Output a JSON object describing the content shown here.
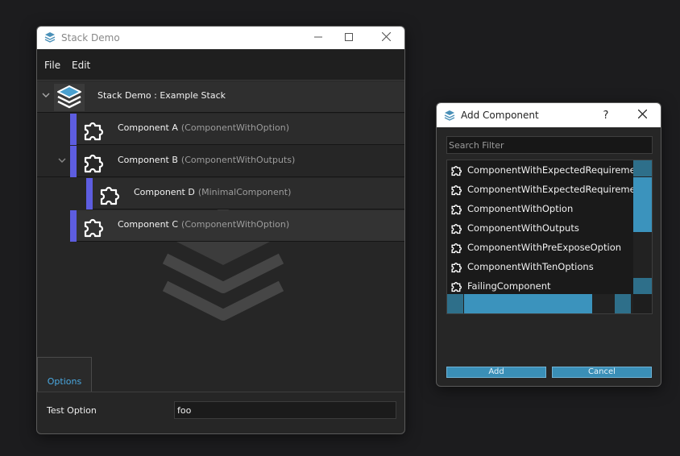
{
  "main_window": {
    "title": "Stack Demo",
    "app_icon": "stack-icon",
    "menu": [
      "File",
      "Edit"
    ],
    "tree": {
      "root": {
        "name": "Stack Demo : Example Stack",
        "icon": "stack-icon",
        "expanded": true
      },
      "items": [
        {
          "name": "Component A",
          "type": "(ComponentWithOption)",
          "depth": 1,
          "icon": "puzzle-icon",
          "expandable": false
        },
        {
          "name": "Component B",
          "type": "(ComponentWithOutputs)",
          "depth": 1,
          "icon": "puzzle-icon",
          "expandable": true
        },
        {
          "name": "Component D",
          "type": "(MinimalComponent)",
          "depth": 2,
          "icon": "puzzle-icon",
          "expandable": false
        },
        {
          "name": "Component C",
          "type": "(ComponentWithOption)",
          "depth": 1,
          "icon": "puzzle-icon",
          "expandable": false
        }
      ]
    },
    "tabs": [
      "Options"
    ],
    "options": [
      {
        "label": "Test Option",
        "value": "foo"
      }
    ],
    "colors": {
      "bar": "#5d5de0",
      "tab_text": "#4aa8e0"
    }
  },
  "dialog": {
    "title": "Add Component",
    "help": "?",
    "close": "✕",
    "search_placeholder": "Search Filter",
    "items": [
      "ComponentWithExpectedRequirement",
      "ComponentWithExpectedRequirement",
      "ComponentWithOption",
      "ComponentWithOutputs",
      "ComponentWithPreExposeOption",
      "ComponentWithTenOptions",
      "FailingComponent"
    ],
    "add_label": "Add",
    "cancel_label": "Cancel",
    "colors": {
      "accent": "#3b93bd"
    }
  }
}
